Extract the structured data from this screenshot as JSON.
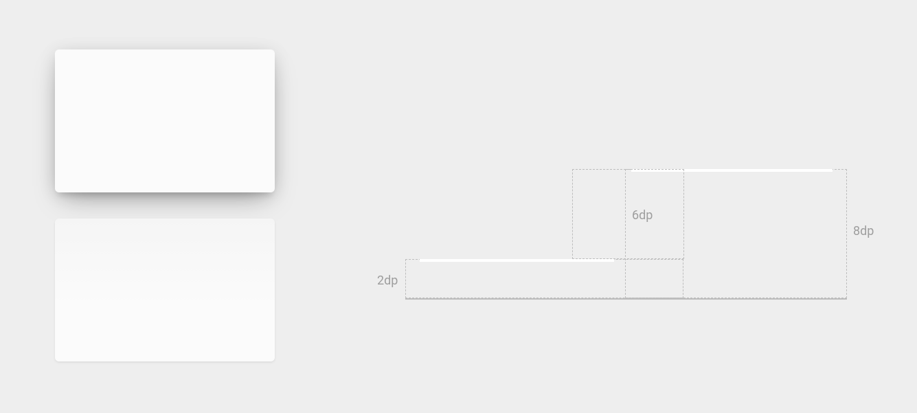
{
  "elevations": {
    "label_2dp": "2dp",
    "label_6dp": "6dp",
    "label_8dp": "8dp"
  }
}
